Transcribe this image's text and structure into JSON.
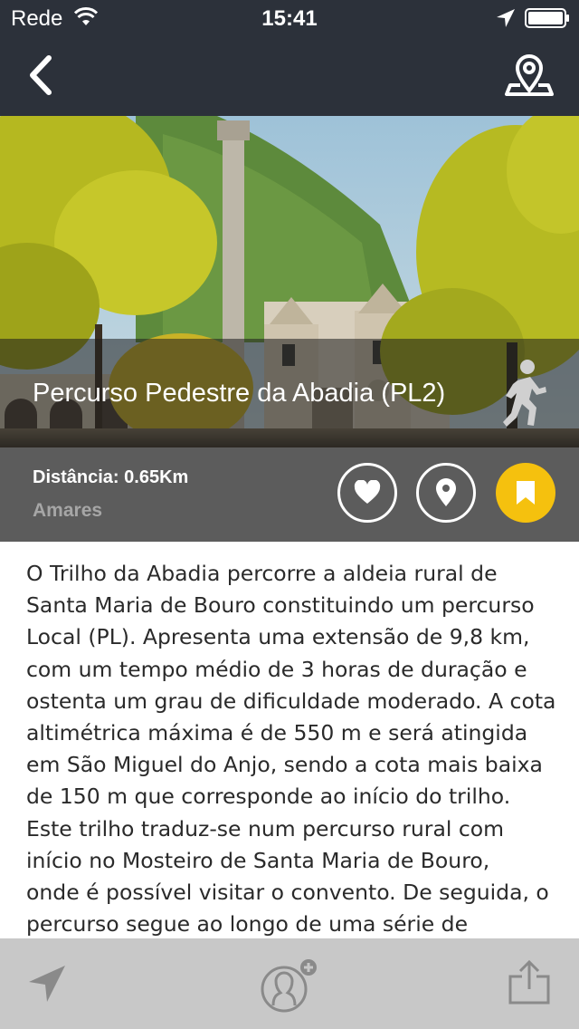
{
  "status_bar": {
    "carrier": "Rede",
    "time": "15:41"
  },
  "nav": {
    "back_icon": "chevron-left-icon",
    "map_icon": "map-pin-icon"
  },
  "hero": {
    "title": "Percurso Pedestre da Abadia (PL2)",
    "activity_icon": "walker-icon"
  },
  "info": {
    "distance": "Distância: 0.65Km",
    "location": "Amares",
    "bookmark_color": "#f5c10e"
  },
  "description": {
    "lines": [
      "O Trilho da Abadia percorre a aldeia rural de",
      "Santa Maria de Bouro constituindo um percurso",
      "Local (PL). Apresenta uma extensão de 9,8 km,",
      "com um tempo médio de 3 horas de duração e",
      "ostenta um grau de dificuldade moderado. A cota",
      "altimétrica máxima é de 550 m e será atingida",
      "em São Miguel do Anjo, sendo a cota mais baixa",
      "de 150 m que corresponde ao início do trilho.",
      "Este trilho traduz-se num percurso rural com",
      "início no Mosteiro de Santa Maria de Bouro,",
      "onde é possível visitar o convento. De seguida, o",
      "percurso segue ao longo de uma série de"
    ]
  },
  "toolbar": {
    "nav_icon": "navigation-arrow-icon",
    "guide_icon": "add-guide-icon",
    "share_icon": "share-icon"
  }
}
